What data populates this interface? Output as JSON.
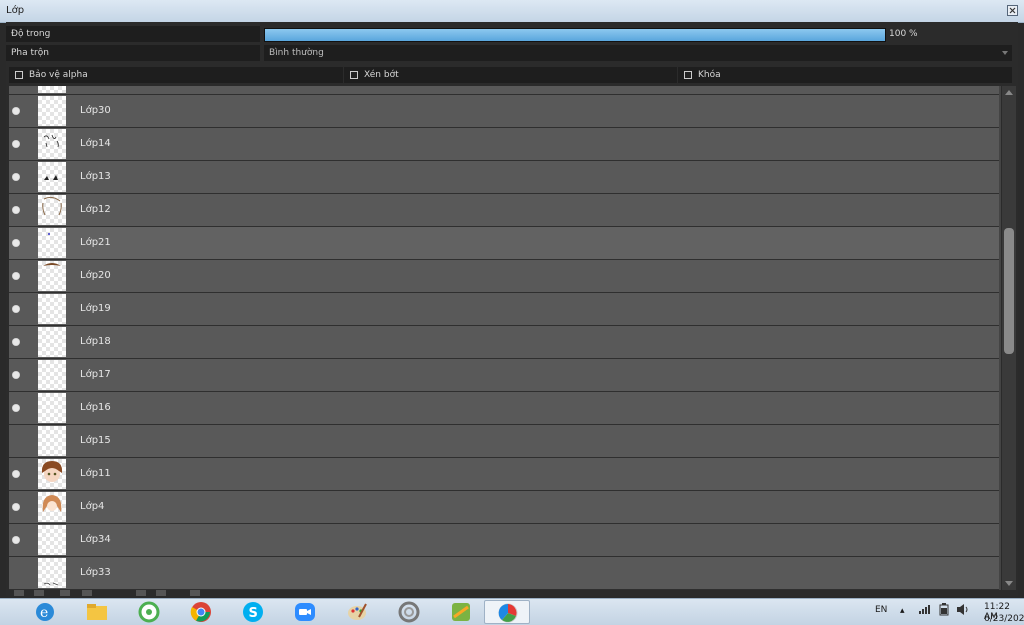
{
  "window": {
    "title": "Lớp"
  },
  "opacity": {
    "label": "Độ trong",
    "value_text": "100 %",
    "value": 100
  },
  "blend": {
    "label": "Pha trộn",
    "selected": "Bình thường"
  },
  "options": [
    {
      "label": "Bảo vệ alpha",
      "checked": false
    },
    {
      "label": "Xén bớt",
      "checked": false
    },
    {
      "label": "Khóa",
      "checked": false
    }
  ],
  "layers": [
    {
      "name": "Lớp30",
      "visible": true
    },
    {
      "name": "Lớp14",
      "visible": true
    },
    {
      "name": "Lớp13",
      "visible": true
    },
    {
      "name": "Lớp12",
      "visible": true
    },
    {
      "name": "Lớp21",
      "visible": true,
      "selected": true
    },
    {
      "name": "Lớp20",
      "visible": true
    },
    {
      "name": "Lớp19",
      "visible": true
    },
    {
      "name": "Lớp18",
      "visible": true
    },
    {
      "name": "Lớp17",
      "visible": true
    },
    {
      "name": "Lớp16",
      "visible": true
    },
    {
      "name": "Lớp15",
      "visible": false
    },
    {
      "name": "Lớp11",
      "visible": true
    },
    {
      "name": "Lớp4",
      "visible": true
    },
    {
      "name": "Lớp34",
      "visible": true
    },
    {
      "name": "Lớp33",
      "visible": false
    }
  ],
  "taskbar": {
    "apps": [
      "internet-explorer-icon",
      "file-explorer-icon",
      "coccoc-icon",
      "chrome-icon",
      "skype-icon",
      "zoom-icon",
      "paint-icon",
      "creative-cloud-icon",
      "game-icon",
      "medibang-icon"
    ],
    "language": "EN",
    "time": "11:22 AM",
    "date": "6/23/202"
  },
  "colors": {
    "accent": "#5aa6dd",
    "panel": "#2b2b2b",
    "layer_row": "#595959"
  }
}
